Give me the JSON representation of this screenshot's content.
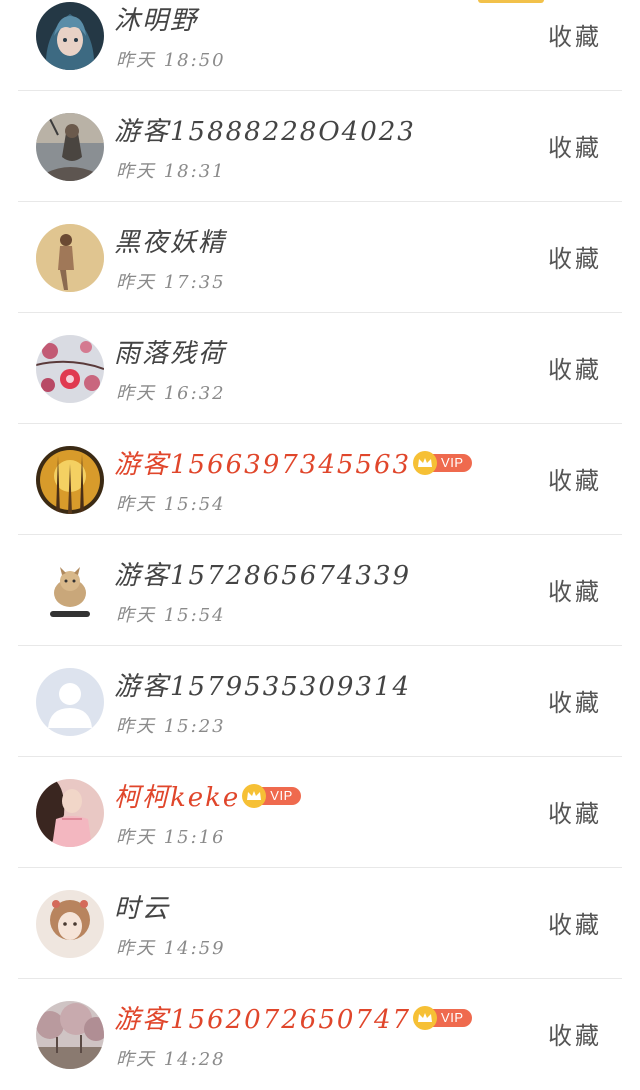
{
  "accent_color": "#f2c14a",
  "vip_name_color": "#e0462b",
  "vip_badge_text": "VIP",
  "favorite_label": "收藏",
  "rows": [
    {
      "name": "沐明野",
      "time": "昨天 18:50",
      "vip": false,
      "avatar_icon": "anime-girl-avatar"
    },
    {
      "name": "游客15888228O4023",
      "time": "昨天 18:31",
      "vip": false,
      "avatar_icon": "figure-photo-avatar"
    },
    {
      "name": "黑夜妖精",
      "time": "昨天 17:35",
      "vip": false,
      "avatar_icon": "woman-photo-avatar"
    },
    {
      "name": "雨落残荷",
      "time": "昨天 16:32",
      "vip": false,
      "avatar_icon": "plum-blossom-avatar"
    },
    {
      "name": "游客1566397345563",
      "time": "昨天 15:54",
      "vip": true,
      "avatar_icon": "autumn-forest-avatar"
    },
    {
      "name": "游客1572865674339",
      "time": "昨天 15:54",
      "vip": false,
      "avatar_icon": "kitten-avatar"
    },
    {
      "name": "游客1579535309314",
      "time": "昨天 15:23",
      "vip": false,
      "avatar_icon": "default-person-avatar"
    },
    {
      "name": "柯柯keke",
      "time": "昨天 15:16",
      "vip": true,
      "avatar_icon": "pink-dress-avatar"
    },
    {
      "name": "时云",
      "time": "昨天 14:59",
      "vip": false,
      "avatar_icon": "doll-avatar"
    },
    {
      "name": "游客1562072650747",
      "time": "昨天 14:28",
      "vip": true,
      "avatar_icon": "cherry-trees-avatar"
    }
  ]
}
